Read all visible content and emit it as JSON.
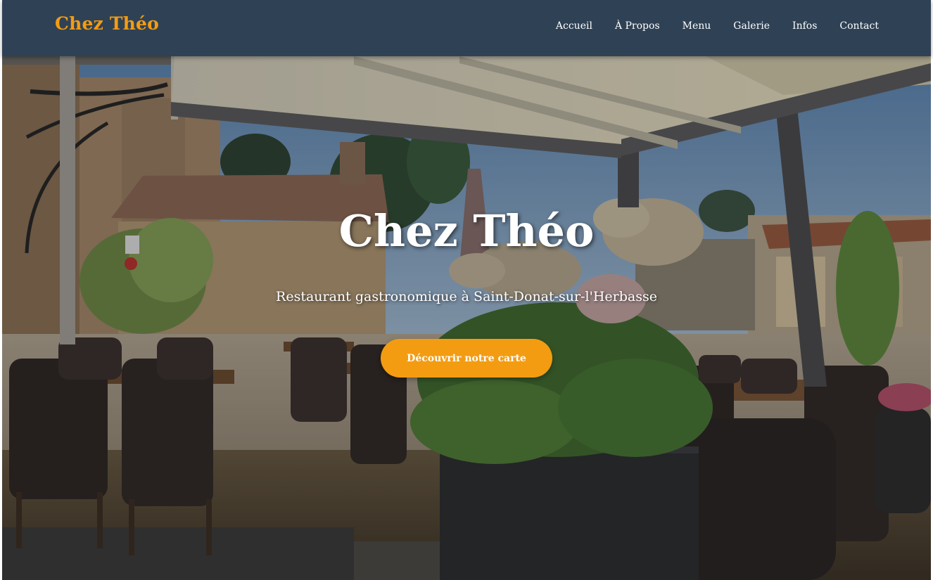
{
  "header": {
    "logo": "Chez Théo",
    "nav": [
      {
        "label": "Accueil"
      },
      {
        "label": "À Propos"
      },
      {
        "label": "Menu"
      },
      {
        "label": "Galerie"
      },
      {
        "label": "Infos"
      },
      {
        "label": "Contact"
      }
    ]
  },
  "hero": {
    "title": "Chez Théo",
    "subtitle": "Restaurant gastronomique à Saint-Donat-sur-l'Herbasse",
    "cta_label": "Découvrir notre carte",
    "background_image": "restaurant-terrace-photo"
  },
  "colors": {
    "header_bg": "#2f4255",
    "accent": "#f39c12",
    "text_light": "#ffffff"
  }
}
